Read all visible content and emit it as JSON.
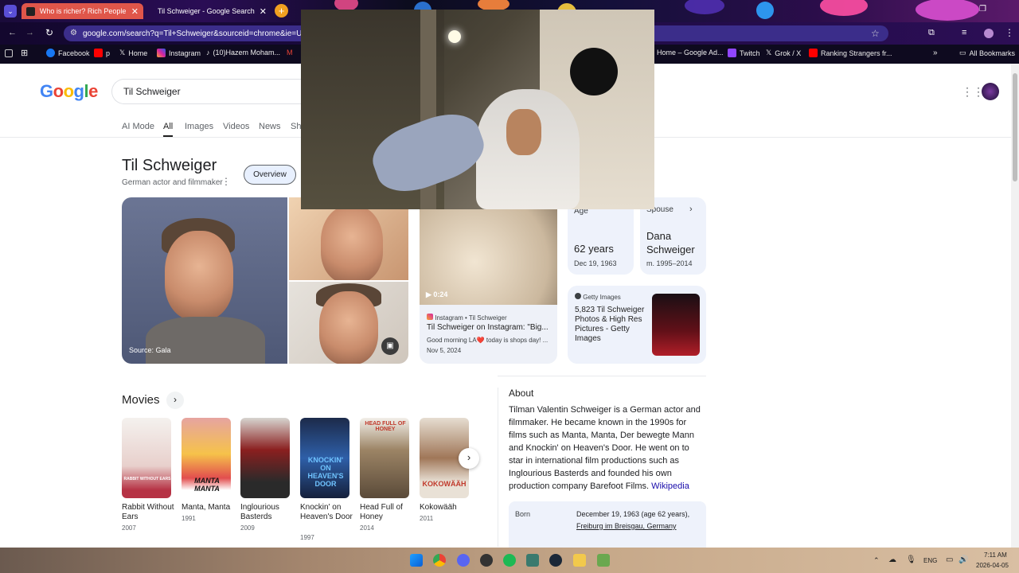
{
  "browser": {
    "tabs": [
      {
        "title": "Who is richer? Rich People | Mo",
        "active": false
      },
      {
        "title": "Til Schweiger - Google Search",
        "active": true
      }
    ],
    "url": "google.com/search?q=Til+Schweiger&sourceid=chrome&ie=UTF-",
    "bookmarks": [
      "Facebook",
      "p",
      "Home",
      "Instagram",
      "(10)Hazem Moham...",
      "Home – Google Ad...",
      "Twitch",
      "Grok / X",
      "Ranking Strangers fr..."
    ],
    "all_bookmarks": "All Bookmarks",
    "new_tab_symbol": "+",
    "overflow_symbol": "»"
  },
  "google": {
    "logo": [
      "G",
      "o",
      "o",
      "g",
      "l",
      "e"
    ],
    "logo_colors": [
      "#4285F4",
      "#EA4335",
      "#FBBC05",
      "#4285F4",
      "#34A853",
      "#EA4335"
    ],
    "query": "Til Schweiger",
    "tabs": [
      "AI Mode",
      "All",
      "Images",
      "Videos",
      "News",
      "Sh"
    ],
    "active_tab": "All"
  },
  "knowledge_panel": {
    "title": "Til Schweiger",
    "subtitle": "German actor and filmmaker",
    "overview_button": "Overview",
    "image_source": "Source: Gala",
    "video": {
      "duration": "0:24",
      "source": "Instagram • Til Schweiger",
      "title": "Til Schweiger on Instagram: \"Big...",
      "snippet": "Good morning LA❤️ today is shops day! ...",
      "date": "Nov 5, 2024"
    },
    "age": {
      "label": "Age",
      "value": "62 years",
      "detail": "Dec 19, 1963"
    },
    "spouse": {
      "label": "Spouse",
      "value": "Dana Schweiger",
      "detail": "m. 1995–2014"
    },
    "getty": {
      "source": "Getty Images",
      "text": "5,823 Til Schweiger Photos & High Res Pictures - Getty Images"
    }
  },
  "movies": {
    "heading": "Movies",
    "items": [
      {
        "title": "Rabbit Without Ears",
        "year": "2007",
        "poster_text": "RABBIT WITHOUT EARS"
      },
      {
        "title": "Manta, Manta",
        "year": "1991",
        "poster_text": "MANTA MANTA"
      },
      {
        "title": "Inglourious Basterds",
        "year": "2009",
        "poster_text": ""
      },
      {
        "title": "Knockin' on Heaven's Door",
        "year": "1997",
        "poster_text": "KNOCKIN' ON HEAVEN'S DOOR"
      },
      {
        "title": "Head Full of Honey",
        "year": "2014",
        "poster_text": "HEAD FULL OF HONEY"
      },
      {
        "title": "Kokowääh",
        "year": "2011",
        "poster_text": "KOKOWÄÄH"
      }
    ]
  },
  "about": {
    "heading": "About",
    "text": "Tilman Valentin Schweiger is a German actor and filmmaker. He became known in the 1990s for films such as Manta, Manta, Der bewegte Mann and Knockin' on Heaven's Door. He went on to star in international film productions such as Inglourious Basterds and founded his own production company Barefoot Films.",
    "link": "Wikipedia",
    "born_label": "Born",
    "born_value": "December 19, 1963 (age 62 years),",
    "born_place": "Freiburg im Breisgau, Germany"
  },
  "taskbar": {
    "lang": "ENG",
    "time": "7:11 AM",
    "date": "2026-04-05"
  }
}
